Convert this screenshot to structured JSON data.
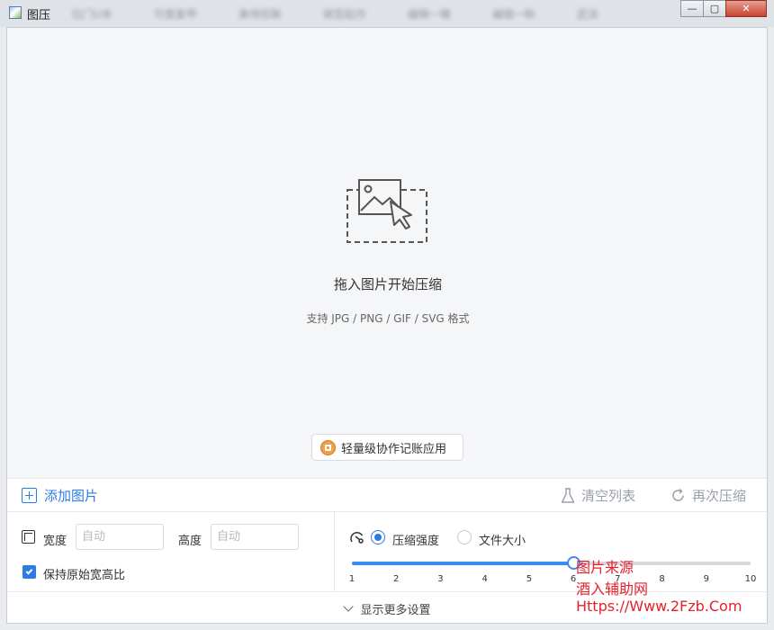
{
  "window": {
    "title": "图压",
    "min_glyph": "—",
    "max_glyph": "▢",
    "close_glyph": "✕",
    "background_tabs": [
      "拉门U本",
      "可度复甲",
      "美侍招联",
      "继型起作",
      "编辑一桶",
      "编辑一盼",
      "武派"
    ]
  },
  "dropzone": {
    "icon": "image-drop-icon",
    "title": "拖入图片开始压缩",
    "subtitle": "支持 JPG / PNG / GIF / SVG 格式"
  },
  "promo": {
    "label": "轻量级协作记账应用",
    "icon": "app-badge-icon"
  },
  "toolbar": {
    "add_label": "添加图片",
    "clear_label": "清空列表",
    "recompress_label": "再次压缩"
  },
  "settings": {
    "width_label": "宽度",
    "width_placeholder": "自动",
    "height_label": "高度",
    "height_placeholder": "自动",
    "keep_ratio_label": "保持原始宽高比",
    "keep_ratio_checked": true,
    "mode_strength_label": "压缩强度",
    "mode_size_label": "文件大小",
    "selected_mode": "压缩强度",
    "slider": {
      "min": 1,
      "max": 10,
      "value": 6,
      "ticks": [
        "1",
        "2",
        "3",
        "4",
        "5",
        "6",
        "7",
        "8",
        "9",
        "10"
      ]
    }
  },
  "footer": {
    "more_label": "显示更多设置"
  },
  "watermark": {
    "line1": "图片来源",
    "line2": "酒入辅助网",
    "line3": "Https://Www.2Fzb.Com"
  },
  "colors": {
    "accent": "#2d7be5",
    "disabled": "#9aa0a8",
    "promo_icon": "#f1a04a",
    "watermark": "#e8202a",
    "close_button": "#c7432e"
  }
}
